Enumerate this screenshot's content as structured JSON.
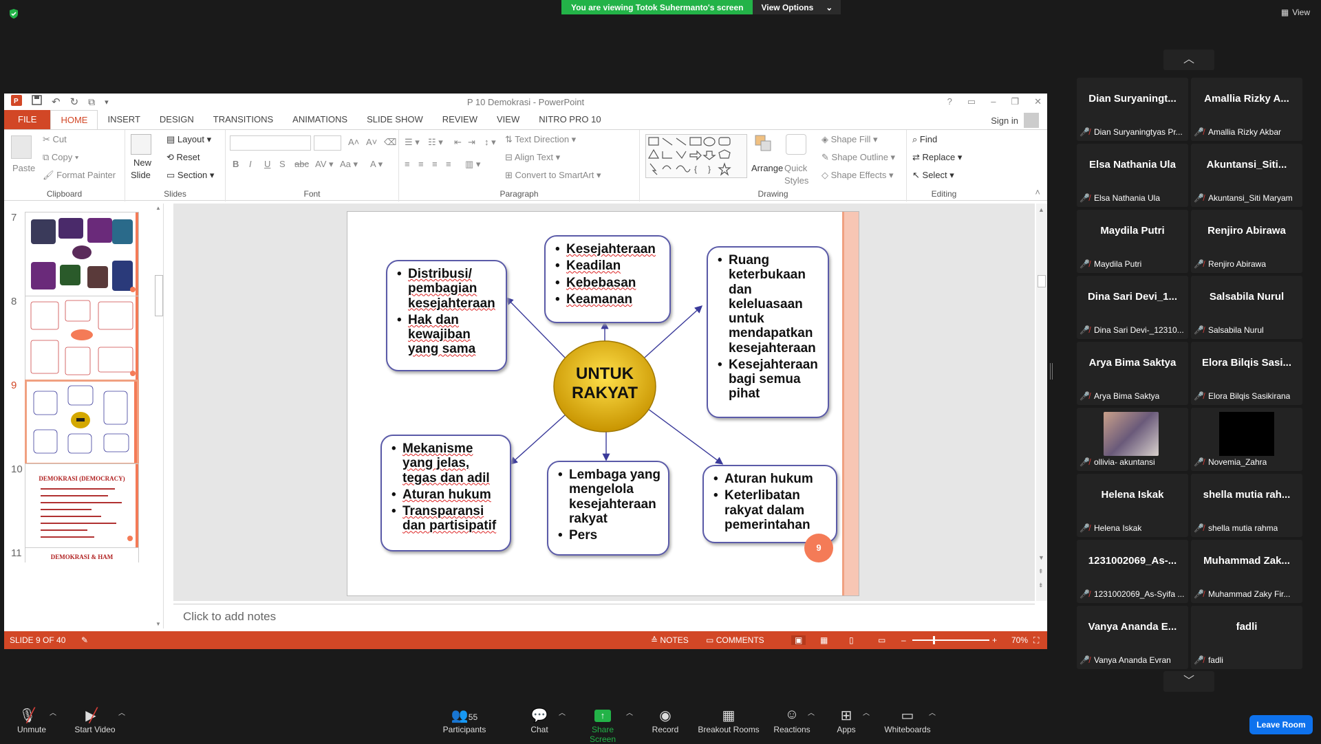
{
  "zoom": {
    "banner_text": "You are viewing Totok Suhermanto's screen",
    "view_options": "View Options",
    "view_label": "View",
    "participants_count": "55",
    "toolbar": [
      {
        "id": "unmute",
        "label": "Unmute"
      },
      {
        "id": "start-video",
        "label": "Start Video"
      },
      {
        "id": "participants",
        "label": "Participants"
      },
      {
        "id": "chat",
        "label": "Chat"
      },
      {
        "id": "share-screen",
        "label": "Share Screen"
      },
      {
        "id": "record",
        "label": "Record"
      },
      {
        "id": "breakout-rooms",
        "label": "Breakout Rooms"
      },
      {
        "id": "reactions",
        "label": "Reactions"
      },
      {
        "id": "apps",
        "label": "Apps"
      },
      {
        "id": "whiteboards",
        "label": "Whiteboards"
      }
    ],
    "leave_label": "Leave Room",
    "participants": [
      {
        "name": "Dian  Suryaningt...",
        "label": "Dian Suryaningtyas Pr..."
      },
      {
        "name": "Amallia  Rizky  A...",
        "label": "Amallia Rizky Akbar"
      },
      {
        "name": "Elsa Nathania Ula",
        "label": "Elsa Nathania Ula"
      },
      {
        "name": "Akuntansi_Siti...",
        "label": "Akuntansi_Siti Maryam"
      },
      {
        "name": "Maydila Putri",
        "label": "Maydila Putri"
      },
      {
        "name": "Renjiro Abirawa",
        "label": "Renjiro Abirawa"
      },
      {
        "name": "Dina Sari Devi_1...",
        "label": "Dina Sari Devi-_12310..."
      },
      {
        "name": "Salsabila Nurul",
        "label": "Salsabila Nurul"
      },
      {
        "name": "Arya Bima Saktya",
        "label": "Arya Bima Saktya"
      },
      {
        "name": "Elora Bilqis Sasi...",
        "label": "Elora Bilqis Sasikirana"
      },
      {
        "name": "",
        "label": "ollivia- akuntansi"
      },
      {
        "name": "",
        "label": "Novemia_Zahra"
      },
      {
        "name": "Helena Iskak",
        "label": "Helena Iskak"
      },
      {
        "name": "shella mutia rah...",
        "label": "shella mutia rahma"
      },
      {
        "name": "1231002069_As-...",
        "label": "1231002069_As-Syifa ..."
      },
      {
        "name": "Muhammad  Zak...",
        "label": "Muhammad Zaky Fir..."
      },
      {
        "name": "Vanya Ananda E...",
        "label": "Vanya Ananda Evran"
      },
      {
        "name": "fadli",
        "label": "fadli"
      }
    ]
  },
  "ppt": {
    "window_title": "P 10 Demokrasi - PowerPoint",
    "tabs": [
      "FILE",
      "HOME",
      "INSERT",
      "DESIGN",
      "TRANSITIONS",
      "ANIMATIONS",
      "SLIDE SHOW",
      "REVIEW",
      "VIEW",
      "NITRO PRO 10"
    ],
    "sign_in": "Sign in",
    "ribbon": {
      "clipboard": {
        "paste": "Paste",
        "cut": "Cut",
        "copy": "Copy",
        "format_painter": "Format Painter",
        "label": "Clipboard"
      },
      "slides": {
        "new_slide": "New",
        "new_slide2": "Slide",
        "layout": "Layout",
        "reset": "Reset",
        "section": "Section",
        "label": "Slides"
      },
      "font": {
        "label": "Font"
      },
      "paragraph": {
        "text_direction": "Text Direction",
        "align_text": "Align Text",
        "convert": "Convert to SmartArt",
        "label": "Paragraph"
      },
      "drawing": {
        "arrange": "Arrange",
        "quick": "Quick",
        "styles": "Styles",
        "shape_fill": "Shape Fill",
        "shape_outline": "Shape Outline",
        "shape_effects": "Shape Effects",
        "label": "Drawing"
      },
      "editing": {
        "find": "Find",
        "replace": "Replace",
        "select": "Select",
        "label": "Editing"
      }
    },
    "thumbnails": [
      {
        "num": "7"
      },
      {
        "num": "8"
      },
      {
        "num": "9"
      },
      {
        "num": "10",
        "title": "DEMOKRASI (DEMOCRACY)"
      },
      {
        "num": "11",
        "title": "DEMOKRASI & HAM"
      }
    ],
    "notes_placeholder": "Click to add notes",
    "status": {
      "slide_info": "SLIDE 9 OF 40",
      "notes": "NOTES",
      "comments": "COMMENTS",
      "zoom": "70%"
    },
    "slide": {
      "center": [
        "UNTUK",
        "RAKYAT"
      ],
      "page_number": "9",
      "boxes": {
        "top_left": [
          "Distribusi/ pembagian kesejahteraan",
          "Hak dan kewajiban yang sama"
        ],
        "top_center": [
          "Kesejahteraan",
          "Keadilan",
          "Kebebasan",
          "Keamanan"
        ],
        "top_right": [
          "Ruang keterbukaan dan keleluasaan untuk mendapatkan kesejahteraan",
          "Kesejahteraan bagi semua pihat"
        ],
        "bottom_left": [
          "Mekanisme yang jelas, tegas dan adil",
          "Aturan hukum",
          "Transparansi dan partisipatif"
        ],
        "bottom_center": [
          "Lembaga yang mengelola kesejahteraan rakyat",
          "Pers"
        ],
        "bottom_right": [
          "Aturan hukum",
          "Keterlibatan rakyat dalam pemerintahan"
        ]
      }
    }
  }
}
